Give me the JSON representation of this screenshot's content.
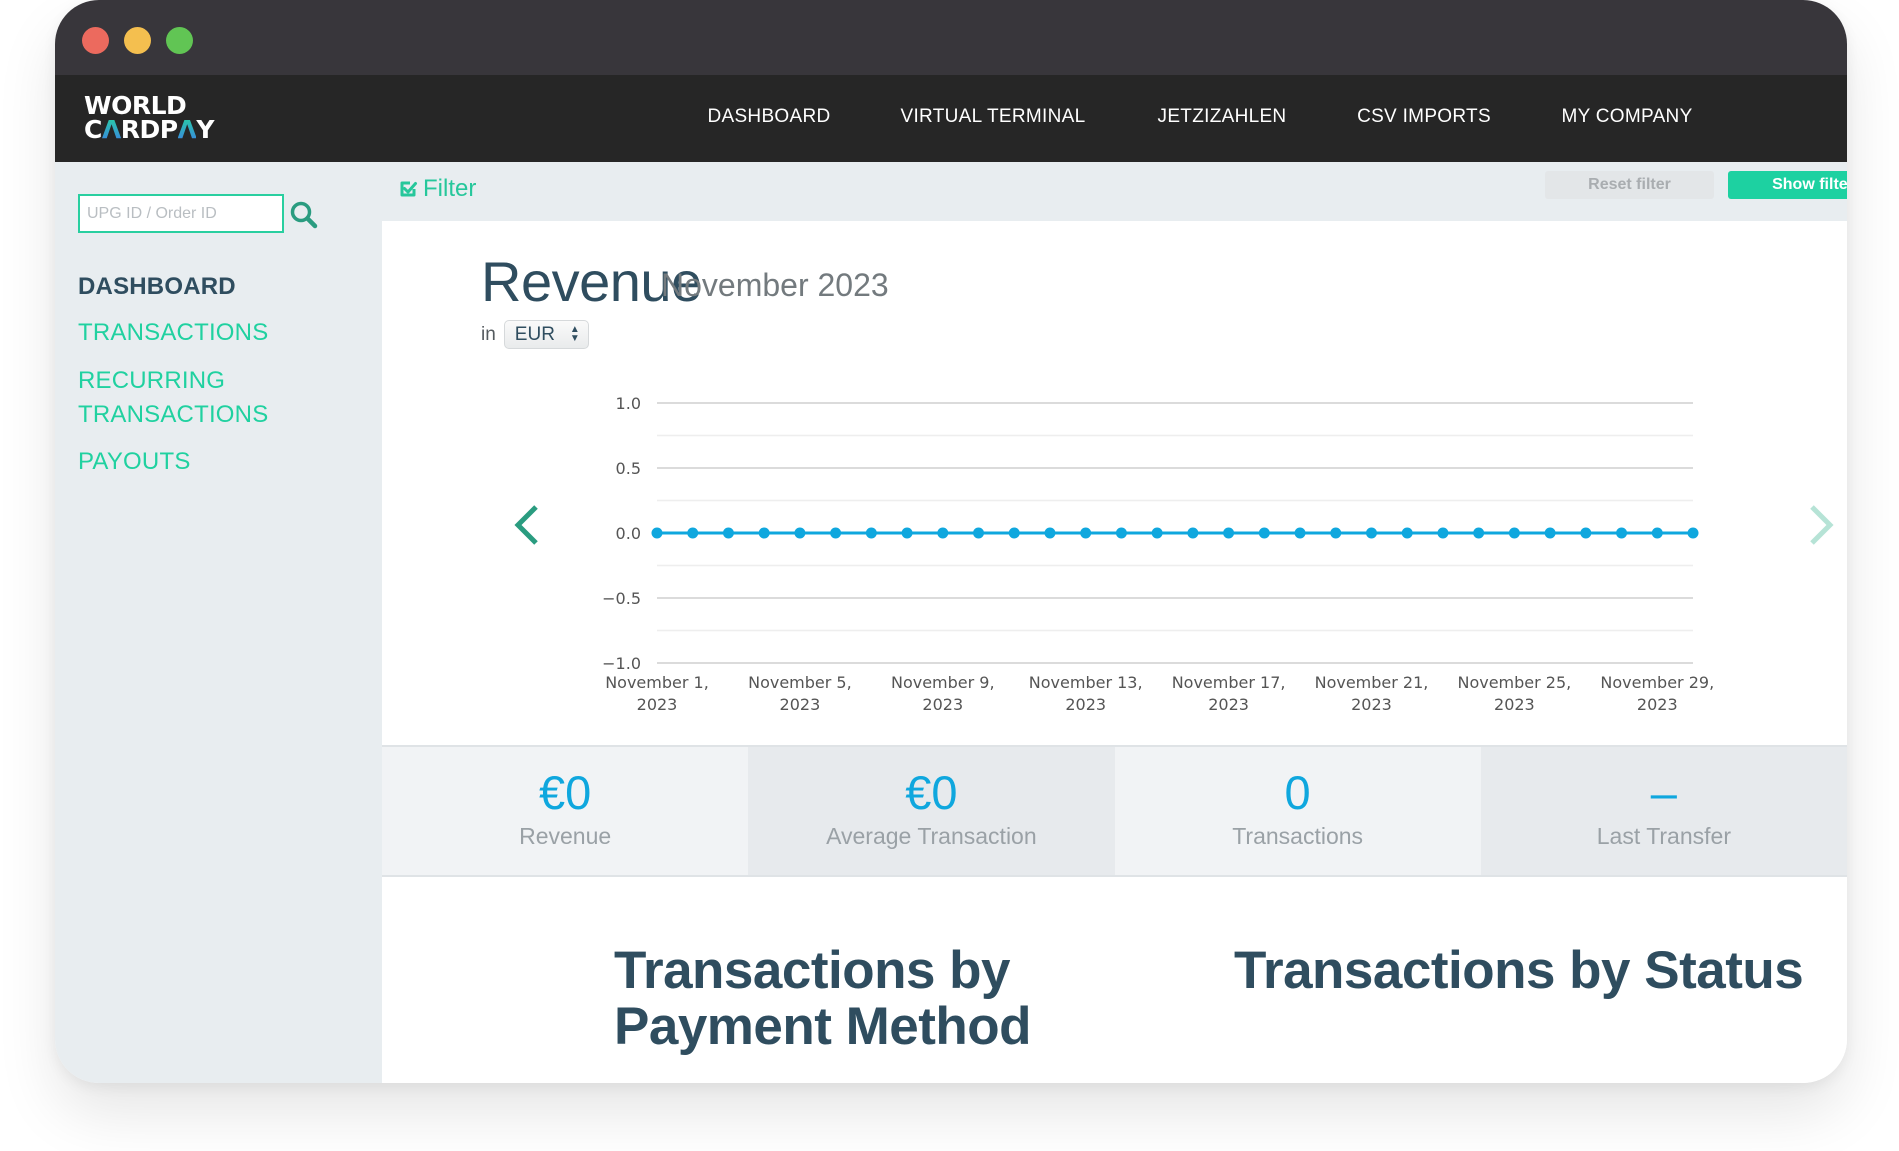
{
  "window": {
    "traffic_lights": [
      "close",
      "minimize",
      "maximize"
    ]
  },
  "brand": {
    "line1": "WORLD",
    "line2_pre": "C",
    "line2_a1": "Λ",
    "line2_mid": "RDP",
    "line2_a2": "Λ",
    "line2_post": "Y",
    "name": "WORLD CARDPAY"
  },
  "topnav": {
    "items": [
      {
        "label": "DASHBOARD"
      },
      {
        "label": "VIRTUAL TERMINAL"
      },
      {
        "label": "JETZIZAHLEN"
      },
      {
        "label": "CSV IMPORTS"
      },
      {
        "label": "MY COMPANY"
      }
    ]
  },
  "sidebar": {
    "search": {
      "placeholder": "UPG ID / Order ID",
      "value": "",
      "icon": "search-icon"
    },
    "items": [
      {
        "label": "DASHBOARD",
        "active": true
      },
      {
        "label": "TRANSACTIONS",
        "active": false
      },
      {
        "label": "RECURRING",
        "label2": "TRANSACTIONS",
        "active": false
      },
      {
        "label": "PAYOUTS",
        "active": false
      }
    ]
  },
  "filterbar": {
    "toggle_label": "Filter",
    "toggle_icon": "check-square-icon",
    "reset_label": "Reset filter",
    "show_label": "Show filter"
  },
  "revenue": {
    "title": "Revenue",
    "period": "November 2023",
    "currency_prefix": "in",
    "currency": "EUR",
    "prev_icon": "chevron-left-icon",
    "next_icon": "chevron-right-icon"
  },
  "stats": [
    {
      "value": "€0",
      "label": "Revenue"
    },
    {
      "value": "€0",
      "label": "Average Transaction"
    },
    {
      "value": "0",
      "label": "Transactions"
    },
    {
      "value": "–",
      "label": "Last Transfer"
    }
  ],
  "sections": {
    "payment_method_title": "Transactions by Payment Method",
    "status_title": "Transactions by Status"
  },
  "colors": {
    "accent_green": "#1dd1a1",
    "line_blue": "#0fa7de",
    "heading_navy": "#2f4d5f",
    "nav_dark": "#262626"
  },
  "chart_data": {
    "type": "line",
    "title": "",
    "xlabel": "",
    "ylabel": "",
    "ylim": [
      -1.0,
      1.0
    ],
    "yticks": [
      "1.0",
      "0.5",
      "0.0",
      "−0.5",
      "−1.0"
    ],
    "ytick_values": [
      1.0,
      0.5,
      0.0,
      -0.5,
      -1.0
    ],
    "minor_grid_values": [
      0.75,
      0.25,
      -0.25,
      -0.75
    ],
    "grid": true,
    "legend": "none",
    "x": [
      1,
      2,
      3,
      4,
      5,
      6,
      7,
      8,
      9,
      10,
      11,
      12,
      13,
      14,
      15,
      16,
      17,
      18,
      19,
      20,
      21,
      22,
      23,
      24,
      25,
      26,
      27,
      28,
      29,
      30
    ],
    "xtick_days": [
      1,
      5,
      9,
      13,
      17,
      21,
      25,
      29
    ],
    "xtick_labels": [
      [
        "November 1,",
        "2023"
      ],
      [
        "November 5,",
        "2023"
      ],
      [
        "November 9,",
        "2023"
      ],
      [
        "November 13,",
        "2023"
      ],
      [
        "November 17,",
        "2023"
      ],
      [
        "November 21,",
        "2023"
      ],
      [
        "November 25,",
        "2023"
      ],
      [
        "November 29,",
        "2023"
      ]
    ],
    "series": [
      {
        "name": "Revenue",
        "color": "#0fa7de",
        "values": [
          0,
          0,
          0,
          0,
          0,
          0,
          0,
          0,
          0,
          0,
          0,
          0,
          0,
          0,
          0,
          0,
          0,
          0,
          0,
          0,
          0,
          0,
          0,
          0,
          0,
          0,
          0,
          0,
          0,
          0
        ]
      }
    ]
  }
}
